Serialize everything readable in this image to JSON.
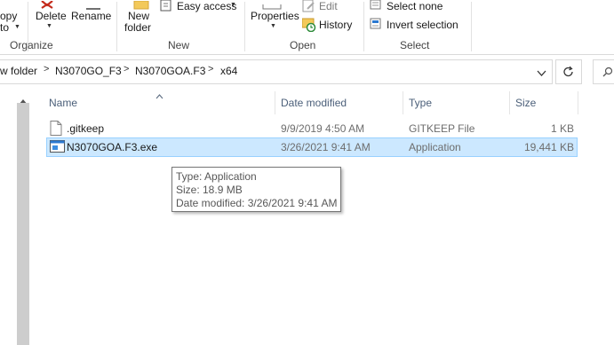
{
  "ribbon": {
    "clipboard": {
      "copy_label": "opy",
      "copy_label2": "to"
    },
    "organize": {
      "label": "Organize",
      "delete_label": "Delete",
      "rename_label": "Rename"
    },
    "new_group": {
      "label": "New",
      "new_folder_label_line1": "New",
      "new_folder_label_line2": "folder",
      "easy_access_label": "Easy access"
    },
    "open_group": {
      "label": "Open",
      "properties_label": "Properties",
      "edit_label": "Edit",
      "history_label": "History"
    },
    "select_group": {
      "label": "Select",
      "select_none_label": "Select none",
      "invert_selection_label": "Invert selection"
    }
  },
  "address": {
    "breadcrumbs": [
      "w folder",
      "N3070GO_F3",
      "N3070GOA.F3",
      "x64"
    ]
  },
  "file_list": {
    "columns": {
      "name": "Name",
      "date_modified": "Date modified",
      "type": "Type",
      "size": "Size"
    },
    "rows": [
      {
        "name": ".gitkeep",
        "date_modified": "9/9/2019 4:50 AM",
        "type": "GITKEEP File",
        "size": "1 KB",
        "icon": "blank-file-icon"
      },
      {
        "name": "N3070GOA.F3.exe",
        "date_modified": "3/26/2021 9:41 AM",
        "type": "Application",
        "size": "19,441 KB",
        "icon": "application-exe-icon",
        "selected": true
      }
    ]
  },
  "tooltip": {
    "type_line": "Type: Application",
    "size_line": "Size: 18.9 MB",
    "date_line": "Date modified: 3/26/2021 9:41 AM"
  },
  "colors": {
    "selection_bg": "#cce8ff",
    "selection_border": "#99d1ff",
    "header_text": "#4c607a",
    "icon_red": "#c42b1c",
    "icon_blue": "#2b79d0"
  }
}
